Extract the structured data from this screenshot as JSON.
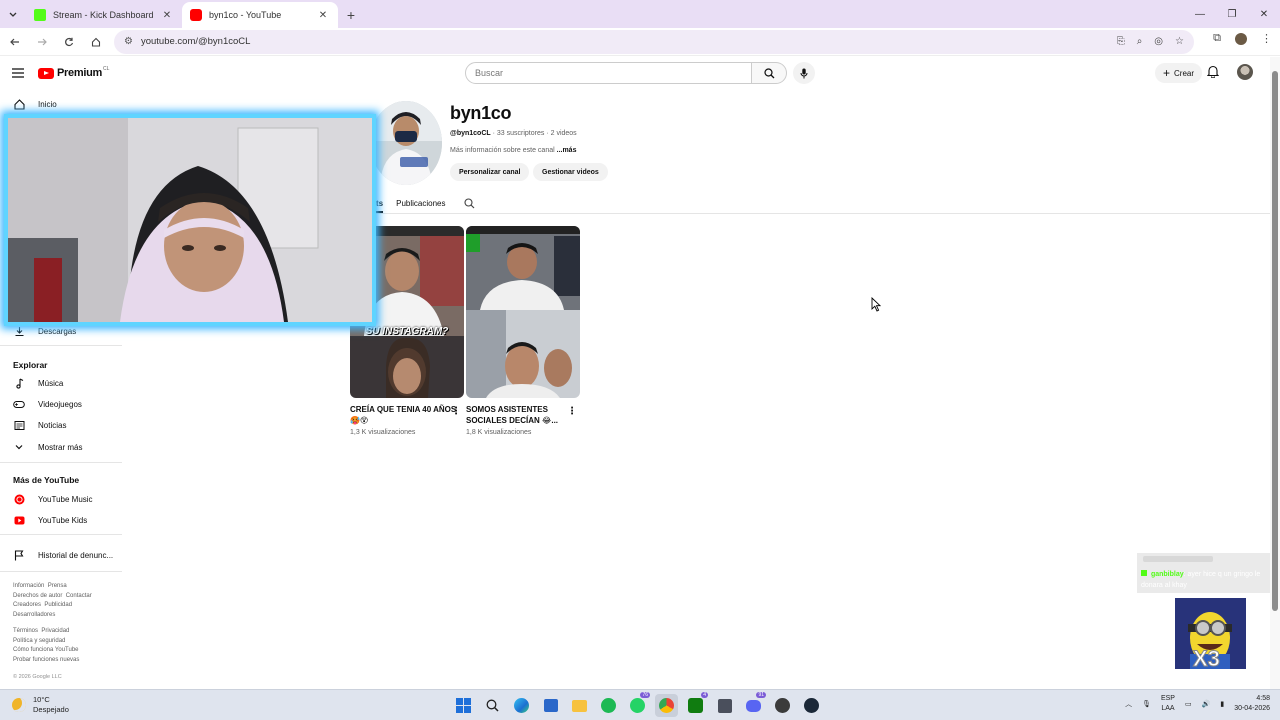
{
  "browser": {
    "tabs": [
      {
        "title": "Stream - Kick Dashboard",
        "favicon_color": "#53fc18"
      },
      {
        "title": "byn1co - YouTube",
        "favicon_color": "#ff0000"
      }
    ],
    "url": "youtube.com/@byn1coCL"
  },
  "yt_header": {
    "logo_text": "Premium",
    "logo_country": "CL",
    "search_placeholder": "Buscar",
    "create_label": "Crear"
  },
  "sidebar": {
    "home": "Inicio",
    "downloads": "Descargas",
    "explore_title": "Explorar",
    "explore_items": [
      "Música",
      "Videojuegos",
      "Noticias",
      "Mostrar más"
    ],
    "more_title": "Más de YouTube",
    "more_items": [
      "YouTube Music",
      "YouTube Kids"
    ],
    "report_history": "Historial de denunc...",
    "footer1": [
      "Información",
      "Prensa",
      "Derechos de autor",
      "Contactar",
      "Creadores",
      "Publicidad",
      "Desarrolladores"
    ],
    "footer2": [
      "Términos",
      "Privacidad",
      "Política y seguridad",
      "Cómo funciona YouTube",
      "Probar funciones nuevas"
    ],
    "copyright": "© 2026 Google LLC"
  },
  "channel": {
    "name": "byn1co",
    "handle": "@byn1coCL",
    "subscribers": "33 suscriptores",
    "videos": "2 videos",
    "more_info": "Más información sobre este canal",
    "more_link": "...más",
    "customize": "Personalizar canal",
    "manage": "Gestionar videos",
    "tab_partial": "ts",
    "tab_posts": "Publicaciones"
  },
  "shorts": [
    {
      "title": "CREÍA QUE TENIA 40 AÑOS 🥵😵",
      "views": "1,3 K visualizaciones",
      "overlay": "SU INSTAGRAM?"
    },
    {
      "title": "SOMOS ASISTENTES SOCIALES DECÍAN 😂...",
      "views": "1,8 K visualizaciones",
      "overlay": ""
    }
  ],
  "chat": {
    "line1_user": "ganbiblay",
    "line1_text": "ayer hice q un gringo le donara al khay"
  },
  "sticker_text": "X3",
  "taskbar": {
    "temp": "10°C",
    "weather": "Despejado",
    "lang_top": "ESP",
    "lang_bottom": "LAA",
    "time": "4:58",
    "date": "30-04-2026",
    "badges": {
      "whatsapp": "76",
      "xbox": "4",
      "discord": "91"
    }
  },
  "colors": {
    "kick_green": "#53fc18",
    "yt_red": "#ff0000",
    "cam_border": "#5fd4ff",
    "tab_bar": "#e9def5"
  }
}
